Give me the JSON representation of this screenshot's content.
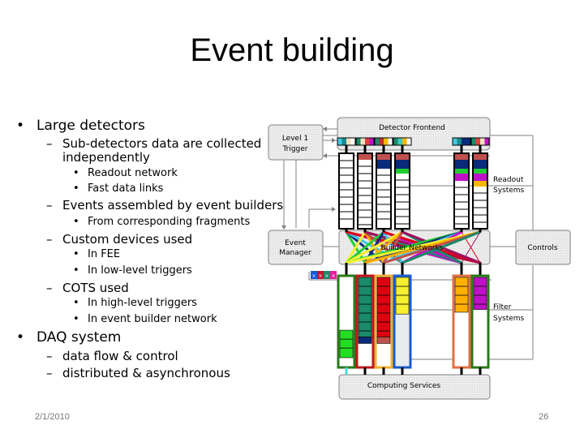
{
  "slide": {
    "title": "Event building",
    "footer": {
      "date": "2/1/2010",
      "page": "26"
    }
  },
  "bullets": [
    {
      "level": 1,
      "text": "Large detectors"
    },
    {
      "level": 2,
      "text": "Sub-detectors data are collected"
    },
    {
      "level": 2,
      "text": "independently",
      "continuation": true
    },
    {
      "level": 3,
      "text": "Readout network"
    },
    {
      "level": 3,
      "text": "Fast data links"
    },
    {
      "level": 2,
      "text": "Events assembled by event builders"
    },
    {
      "level": 3,
      "text": " From corresponding fragments"
    },
    {
      "level": 2,
      "text": "Custom devices used"
    },
    {
      "level": 3,
      "text": "In FEE"
    },
    {
      "level": 3,
      "text": "In low-level triggers"
    },
    {
      "level": 2,
      "text": "COTS used"
    },
    {
      "level": 3,
      "text": "In high-level triggers"
    },
    {
      "level": 3,
      "text": "In event builder network"
    },
    {
      "level": 1,
      "text": "DAQ system"
    },
    {
      "level": 2,
      "text": "data flow & control"
    },
    {
      "level": 2,
      "text": "distributed & asynchronous"
    }
  ],
  "markers": {
    "l1": "•",
    "l2": "–",
    "l3": "•"
  },
  "diagram": {
    "boxes": {
      "detector_frontend": "Detector Frontend",
      "level1_trigger_line1": "Level 1",
      "level1_trigger_line2": "Trigger",
      "event_manager_line1": "Event",
      "event_manager_line2": "Manager",
      "builder_networks": "Builder Networks",
      "controls": "Controls",
      "computing_services": "Computing Services"
    },
    "labels": {
      "readout_line1": "Readout",
      "readout_line2": "Systems",
      "filter_line1": "Filter",
      "filter_line2": "Systems"
    },
    "colors": {
      "box_fill": "#e8e8e8",
      "box_stroke": "#808080",
      "line": "#808080",
      "rose": "#c0504d",
      "navy": "#0a2a7a",
      "green": "#22cc33",
      "magenta": "#c010c8",
      "amber": "#f8b800",
      "teal": "#1a8a6a",
      "red": "#dd0011",
      "yellow": "#f5f030",
      "orange": "#ffb000",
      "purple": "#c010c8"
    },
    "frontend_chips": [
      [
        "#40c8e0",
        "#1a8a8a",
        "#f0e0c0",
        "#ffffff"
      ],
      [
        "#1a8a6a",
        "#f0e0c0",
        "#e04040",
        "#c010c8"
      ],
      [
        "#1a8a6a",
        "#c03030",
        "#f8b800",
        "#ffffff"
      ],
      [
        "#1a8a6a",
        "#40c8c0",
        "#f8b800",
        "#ffffff"
      ],
      [
        "#40c8e0",
        "#1a8a8a",
        "#0a2a7a",
        "#0a2a7a"
      ],
      [
        "#1a8a6a",
        "#e04040",
        "#f0e0c0",
        "#c010c8"
      ]
    ],
    "readout_columns": [
      {
        "fills": []
      },
      {
        "fills": [
          "#c0504d"
        ]
      },
      {
        "fills": [
          "#c0504d",
          "#0a2a7a"
        ]
      },
      {
        "fills": [
          "#c0504d",
          "#0a2a7a",
          "#22cc33"
        ]
      },
      {
        "fills": [
          "#c0504d",
          "#0a2a7a",
          "#22cc33",
          "#c010c8"
        ]
      },
      {
        "fills": [
          "#c0504d",
          "#0a2a7a",
          "#22cc33",
          "#c010c8",
          "#f8b800"
        ]
      }
    ],
    "filter_columns": [
      {
        "border": "#2a7a1a",
        "fill": "#22dd22",
        "portion": 0.3,
        "position": "bottom"
      },
      {
        "border": "#c01818",
        "fill": "#1a8a6a",
        "portion": 0.65,
        "position": "top",
        "extra": "#0a2a7a"
      },
      {
        "border": "#f0b030",
        "fill": "#dd0011",
        "portion": 0.65,
        "position": "top",
        "extra": "#c0504d"
      },
      {
        "border": "#1a5ad0",
        "fill": "#f5f030",
        "portion": 0.4,
        "position": "top",
        "rest": "#e8ecee"
      },
      {
        "border": "#e07040",
        "fill": "#ffb000",
        "portion": 0.38,
        "position": "top"
      },
      {
        "border": "#2a7a1a",
        "fill": "#c010c8",
        "portion": 0.35,
        "position": "top"
      }
    ],
    "event_manager_tokens": [
      "#1a5ad0",
      "#c01830",
      "#1a8a6a",
      "#e020a0"
    ],
    "network_colors": [
      "#22cc33",
      "#0a2a7a",
      "#40c8e0",
      "#c010c8",
      "#dd0011",
      "#f5f030",
      "#ffb000",
      "#c0504d",
      "#1a8a6a",
      "#a01060"
    ]
  }
}
